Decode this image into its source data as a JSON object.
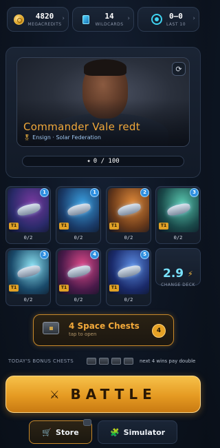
{
  "header": {
    "credits": {
      "value": "4820",
      "label": "MEGACREDITS"
    },
    "wildcards": {
      "value": "14",
      "label": "WILDCARDS"
    },
    "record": {
      "value": "0–0",
      "label": "LAST 10"
    }
  },
  "commander": {
    "name": "Commander Vale redt",
    "rank": "Ensign · Solar Federation",
    "xp": "0 / 100"
  },
  "cards": [
    {
      "level": "1",
      "tier": "T1",
      "count": "0/2",
      "bg": "#2a2a6a",
      "bg2": "#7a3aa0"
    },
    {
      "level": "1",
      "tier": "T1",
      "count": "0/2",
      "bg": "#1a3c6a",
      "bg2": "#3aa0e0"
    },
    {
      "level": "2",
      "tier": "T1",
      "count": "0/2",
      "bg": "#6a3a1a",
      "bg2": "#e08a3a"
    },
    {
      "level": "3",
      "tier": "T1",
      "count": "0/2",
      "bg": "#1a4a4a",
      "bg2": "#5ac8b0"
    },
    {
      "level": "3",
      "tier": "T1",
      "count": "0/2",
      "bg": "#1a4a6a",
      "bg2": "#8ae0f0"
    },
    {
      "level": "4",
      "tier": "T1",
      "count": "0/2",
      "bg": "#4a1a4a",
      "bg2": "#e04a8a"
    },
    {
      "level": "5",
      "tier": "T1",
      "count": "0/2",
      "bg": "#1a2a6a",
      "bg2": "#5a8ae0"
    }
  ],
  "deck": {
    "value": "2.9",
    "label": "CHANGE DECK"
  },
  "chests": {
    "title": "4 Space Chests",
    "subtitle": "tap to open",
    "badge": "4"
  },
  "bonus": {
    "label": "TODAY'S BONUS CHESTS",
    "note": "next 4 wins pay double"
  },
  "battle": {
    "label": "BATTLE"
  },
  "nav": {
    "store": "Store",
    "simulator": "Simulator"
  },
  "icons": {
    "credits": "coin-icon",
    "wildcards": "wildcard-icon",
    "record": "target-icon",
    "refresh": "refresh-icon",
    "rank": "medal-icon",
    "deck": "bolt-icon",
    "battle": "crossed-swords-icon",
    "store": "cart-icon",
    "simulator": "puzzle-icon"
  }
}
